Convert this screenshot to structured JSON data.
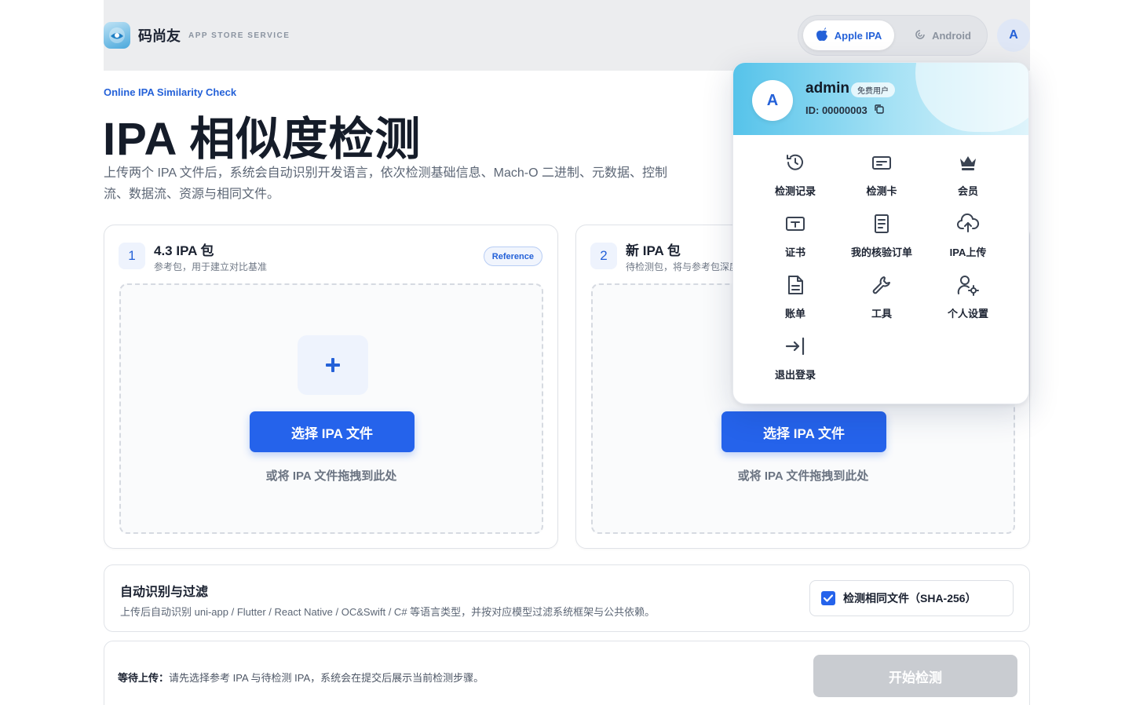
{
  "header": {
    "brand_name": "码尚友",
    "brand_tag": "APP STORE SERVICE",
    "platforms": [
      {
        "label": "Apple IPA",
        "active": true
      },
      {
        "label": "Android",
        "active": false
      }
    ],
    "avatar_initial": "A"
  },
  "hero": {
    "eyebrow": "Online IPA Similarity Check",
    "title": "IPA 相似度检测",
    "description": "上传两个 IPA 文件后，系统会自动识别开发语言，依次检测基础信息、Mach-O 二进制、元数据、控制流、数据流、资源与相同文件。"
  },
  "cards": [
    {
      "step": "1",
      "title": "4.3 IPA 包",
      "subtitle": "参考包，用于建立对比基准",
      "badge": "Reference",
      "select_label": "选择 IPA 文件",
      "drop_hint": "或将 IPA 文件拖拽到此处"
    },
    {
      "step": "2",
      "title": "新 IPA 包",
      "subtitle": "待检测包，将与参考包深度",
      "select_label": "选择 IPA 文件",
      "drop_hint": "或将 IPA 文件拖拽到此处"
    }
  ],
  "filter": {
    "title": "自动识别与过滤",
    "description": "上传后自动识别 uni-app / Flutter / React Native / OC&Swift / C# 等语言类型，并按对应模型过滤系统框架与公共依赖。",
    "checkbox_label": "检测相同文件（SHA-256）",
    "checked": true
  },
  "status": {
    "label": "等待上传：",
    "message": "请先选择参考 IPA 与待检测 IPA，系统会在提交后展示当前检测步骤。",
    "start_label": "开始检测"
  },
  "user_menu": {
    "avatar_initial": "A",
    "username": "admin",
    "badge": "免费用户",
    "uid": "ID: 00000003",
    "items": [
      {
        "label": "检测记录",
        "icon": "history-icon"
      },
      {
        "label": "检测卡",
        "icon": "card-icon"
      },
      {
        "label": "会员",
        "icon": "crown-icon"
      },
      {
        "label": "证书",
        "icon": "certificate-icon"
      },
      {
        "label": "我的核验订单",
        "icon": "order-icon"
      },
      {
        "label": "IPA上传",
        "icon": "cloud-upload-icon"
      },
      {
        "label": "账单",
        "icon": "bill-icon"
      },
      {
        "label": "工具",
        "icon": "wrench-icon"
      },
      {
        "label": "个人设置",
        "icon": "user-settings-icon"
      },
      {
        "label": "退出登录",
        "icon": "logout-icon"
      }
    ]
  },
  "colors": {
    "accent": "#2563eb",
    "disabled": "#c9ccd1"
  }
}
